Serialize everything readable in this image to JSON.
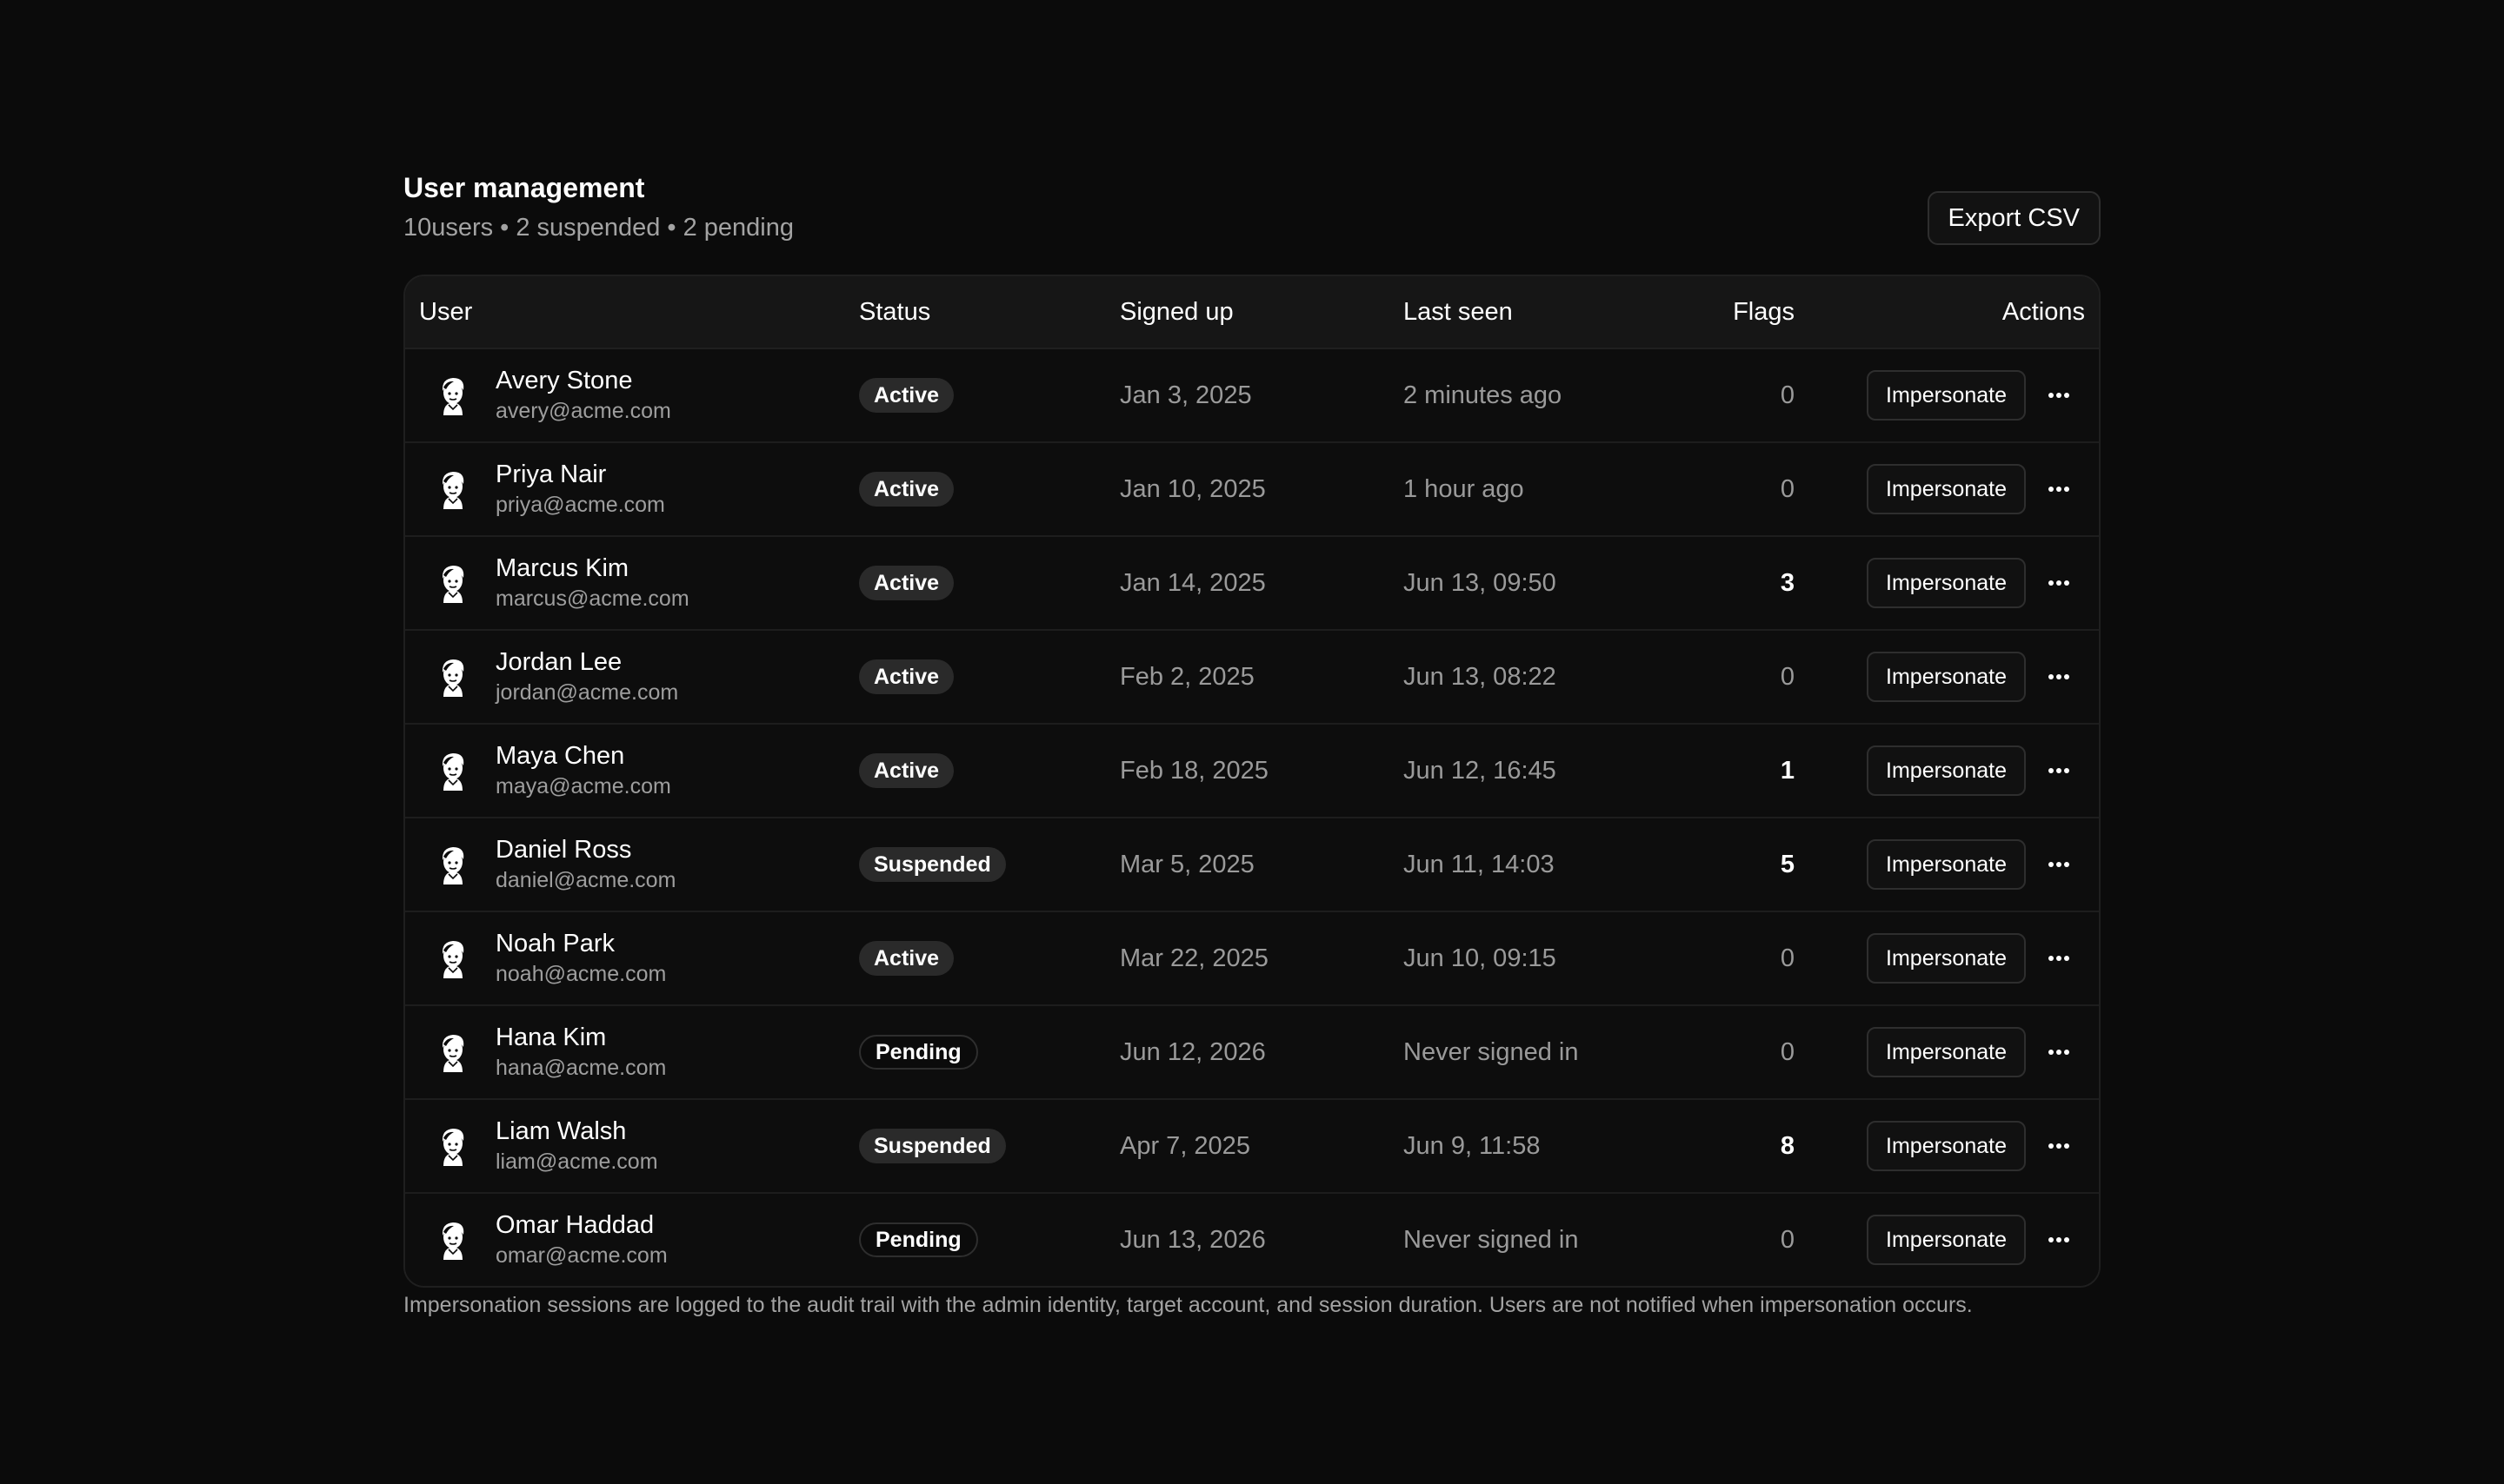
{
  "header": {
    "title": "User management",
    "user_count": "10users",
    "suspended_count": "2 suspended",
    "pending_count": "2 pending",
    "separator": "•",
    "export_label": "Export CSV"
  },
  "columns": {
    "user": "User",
    "status": "Status",
    "signed_up": "Signed up",
    "last_seen": "Last seen",
    "flags": "Flags",
    "actions": "Actions"
  },
  "rows": [
    {
      "name": "Avery Stone",
      "email": "avery@acme.com",
      "status": "Active",
      "signed_up": "Jan 3, 2025",
      "last_seen": "2 minutes ago",
      "flags": "0",
      "impersonate": "Impersonate"
    },
    {
      "name": "Priya Nair",
      "email": "priya@acme.com",
      "status": "Active",
      "signed_up": "Jan 10, 2025",
      "last_seen": "1 hour ago",
      "flags": "0",
      "impersonate": "Impersonate"
    },
    {
      "name": "Marcus Kim",
      "email": "marcus@acme.com",
      "status": "Active",
      "signed_up": "Jan 14, 2025",
      "last_seen": "Jun 13, 09:50",
      "flags": "3",
      "impersonate": "Impersonate"
    },
    {
      "name": "Jordan Lee",
      "email": "jordan@acme.com",
      "status": "Active",
      "signed_up": "Feb 2, 2025",
      "last_seen": "Jun 13, 08:22",
      "flags": "0",
      "impersonate": "Impersonate"
    },
    {
      "name": "Maya Chen",
      "email": "maya@acme.com",
      "status": "Active",
      "signed_up": "Feb 18, 2025",
      "last_seen": "Jun 12, 16:45",
      "flags": "1",
      "impersonate": "Impersonate"
    },
    {
      "name": "Daniel Ross",
      "email": "daniel@acme.com",
      "status": "Suspended",
      "signed_up": "Mar 5, 2025",
      "last_seen": "Jun 11, 14:03",
      "flags": "5",
      "impersonate": "Impersonate"
    },
    {
      "name": "Noah Park",
      "email": "noah@acme.com",
      "status": "Active",
      "signed_up": "Mar 22, 2025",
      "last_seen": "Jun 10, 09:15",
      "flags": "0",
      "impersonate": "Impersonate"
    },
    {
      "name": "Hana Kim",
      "email": "hana@acme.com",
      "status": "Pending",
      "signed_up": "Jun 12, 2026",
      "last_seen": "Never signed in",
      "flags": "0",
      "impersonate": "Impersonate"
    },
    {
      "name": "Liam Walsh",
      "email": "liam@acme.com",
      "status": "Suspended",
      "signed_up": "Apr 7, 2025",
      "last_seen": "Jun 9, 11:58",
      "flags": "8",
      "impersonate": "Impersonate"
    },
    {
      "name": "Omar Haddad",
      "email": "omar@acme.com",
      "status": "Pending",
      "signed_up": "Jun 13, 2026",
      "last_seen": "Never signed in",
      "flags": "0",
      "impersonate": "Impersonate"
    }
  ],
  "icons": {
    "avatar": "avatar-illustration-icon",
    "more": "more-horizontal-icon"
  },
  "footnote": "Impersonation sessions are logged to the audit trail with the admin identity, target account, and session duration. Users are not notified when impersonation occurs.",
  "colors": {
    "background": "#0b0b0b",
    "header_row": "#161616",
    "badge_fill": "#2a2a2a",
    "muted_text": "#9a9a9a"
  }
}
